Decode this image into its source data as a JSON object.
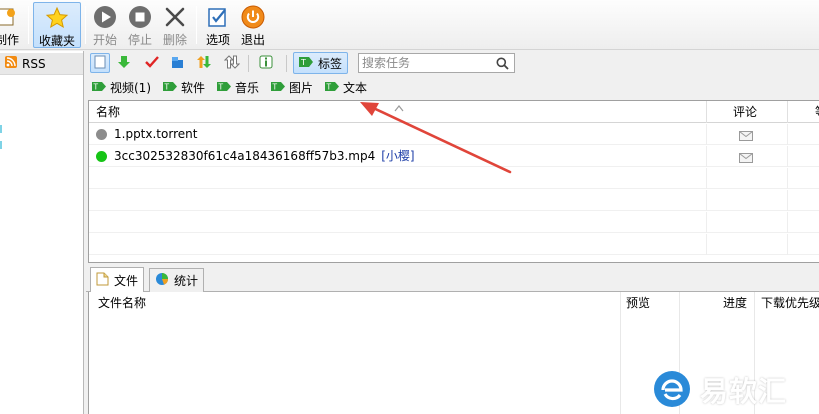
{
  "toolbar": {
    "make_label": "制作",
    "favorites_label": "收藏夹",
    "start_label": "开始",
    "stop_label": "停止",
    "delete_label": "删除",
    "options_label": "选项",
    "exit_label": "退出"
  },
  "sidebar": {
    "rss_label": "RSS"
  },
  "filter": {
    "tag_label": "标签",
    "search_placeholder": "搜索任务"
  },
  "tags": [
    {
      "label": "视频(1)"
    },
    {
      "label": "软件"
    },
    {
      "label": "音乐"
    },
    {
      "label": "图片"
    },
    {
      "label": "文本"
    }
  ],
  "task_list": {
    "columns": {
      "name": "名称",
      "comment": "评论",
      "extra": "等"
    },
    "rows": [
      {
        "status_color": "#8c8c8c",
        "name": "1.pptx.torrent",
        "tag": ""
      },
      {
        "status_color": "#16c416",
        "name": "3cc302532830f61c4a18436168ff57b3.mp4",
        "tag": "[小樱]"
      }
    ]
  },
  "bottom_panel": {
    "tabs": [
      {
        "label": "文件"
      },
      {
        "label": "统计"
      }
    ],
    "columns": {
      "file_name": "文件名称",
      "preview": "预览",
      "progress": "进度",
      "priority": "下载优先级"
    }
  },
  "watermark": {
    "text": "易软汇"
  },
  "colors": {
    "accent": "#7eb4ea",
    "arrow": "#e0453a",
    "tag_green": "#2f9e3a",
    "tag_link": "#1f3fa8"
  }
}
